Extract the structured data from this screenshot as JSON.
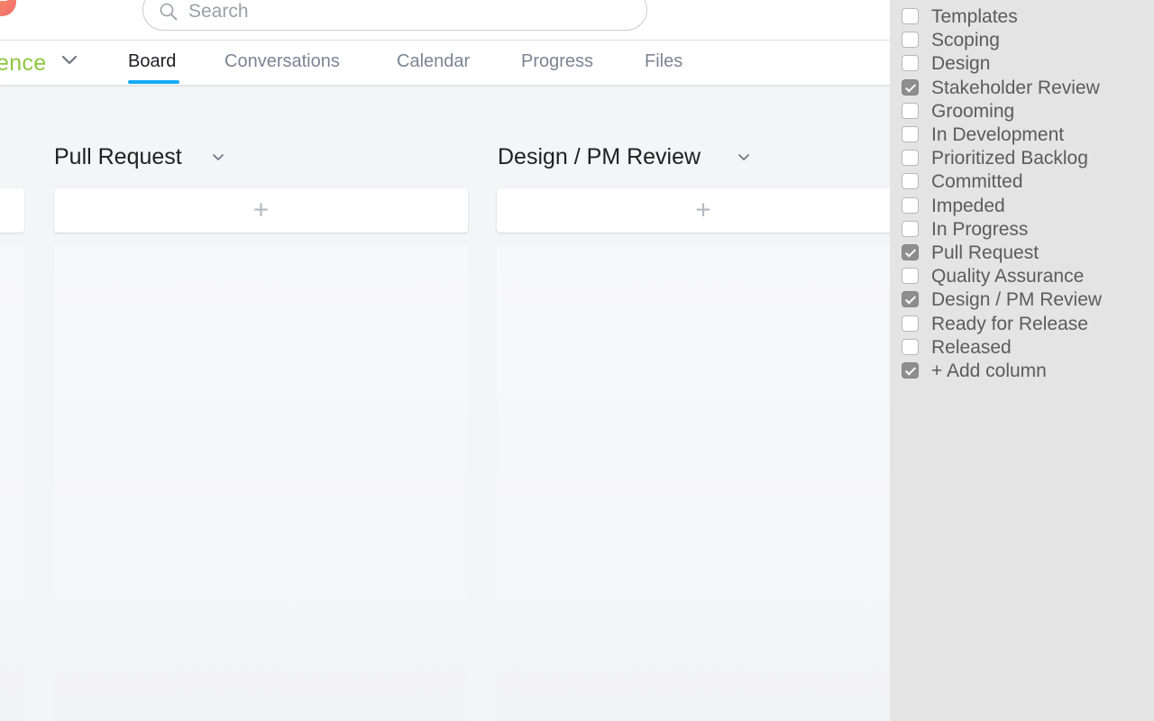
{
  "search": {
    "placeholder": "Search"
  },
  "project": {
    "name": "ence"
  },
  "tabs": [
    {
      "label": "Board",
      "active": true
    },
    {
      "label": "Conversations",
      "active": false
    },
    {
      "label": "Calendar",
      "active": false
    },
    {
      "label": "Progress",
      "active": false
    },
    {
      "label": "Files",
      "active": false
    }
  ],
  "board": {
    "columns": [
      {
        "title": "Pull Request",
        "add_label": "+"
      },
      {
        "title": "Design / PM Review",
        "add_label": "+"
      }
    ]
  },
  "column_picker": {
    "options": [
      {
        "label": "Templates",
        "checked": false
      },
      {
        "label": "Scoping",
        "checked": false
      },
      {
        "label": "Design",
        "checked": false
      },
      {
        "label": "Stakeholder Review",
        "checked": true
      },
      {
        "label": "Grooming",
        "checked": false
      },
      {
        "label": "In Development",
        "checked": false
      },
      {
        "label": "Prioritized Backlog",
        "checked": false
      },
      {
        "label": "Committed",
        "checked": false
      },
      {
        "label": "Impeded",
        "checked": false
      },
      {
        "label": "In Progress",
        "checked": false
      },
      {
        "label": "Pull Request",
        "checked": true
      },
      {
        "label": "Quality Assurance",
        "checked": false
      },
      {
        "label": "Design / PM Review",
        "checked": true
      },
      {
        "label": "Ready for Release",
        "checked": false
      },
      {
        "label": "Released",
        "checked": false
      },
      {
        "label": "+ Add column",
        "checked": true
      }
    ]
  },
  "colors": {
    "accent_tab": "#14aaf5",
    "project_green": "#8ec63f"
  },
  "icons": {
    "search": "search-icon",
    "chevron": "chevron-down-icon",
    "avatar": "avatar"
  }
}
